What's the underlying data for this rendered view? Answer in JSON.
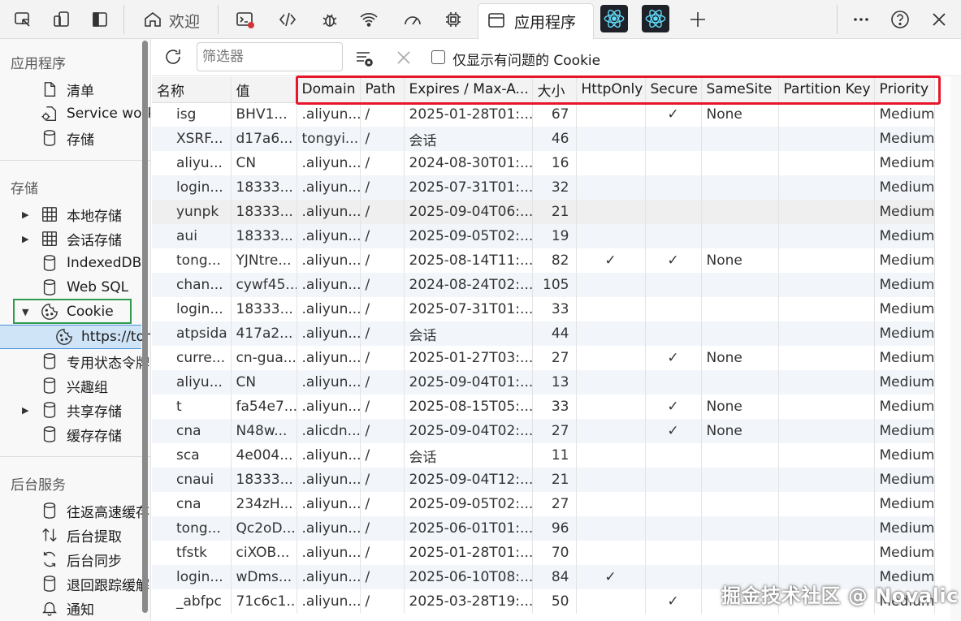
{
  "toolbar": {
    "tabs": [
      {
        "label": "欢迎",
        "icon": "home-icon"
      },
      {
        "label": "",
        "icon": "console-icon"
      },
      {
        "label": "",
        "icon": "sources-icon"
      },
      {
        "label": "",
        "icon": "bug-icon"
      },
      {
        "label": "",
        "icon": "network-icon"
      },
      {
        "label": "",
        "icon": "performance-icon"
      },
      {
        "label": "",
        "icon": "cpu-icon"
      },
      {
        "label": "应用程序",
        "icon": "application-icon"
      },
      {
        "label": "",
        "icon": "react-icon"
      },
      {
        "label": "",
        "icon": "react-icon"
      }
    ],
    "accent": "#0078d4"
  },
  "sidebar": {
    "section_app": "应用程序",
    "app_items": [
      {
        "label": "清单",
        "icon": "file-icon"
      },
      {
        "label": "Service workers",
        "icon": "gear-file-icon"
      },
      {
        "label": "存储",
        "icon": "database-icon"
      }
    ],
    "section_storage": "存储",
    "storage_items": [
      {
        "label": "本地存储",
        "icon": "grid-icon"
      },
      {
        "label": "会话存储",
        "icon": "grid-icon"
      },
      {
        "label": "IndexedDB",
        "icon": "database-icon"
      },
      {
        "label": "Web SQL",
        "icon": "database-icon"
      },
      {
        "label": "Cookie",
        "icon": "cookie-icon"
      },
      {
        "label": "https://tongyi.aliyun.com",
        "icon": "cookie-icon"
      },
      {
        "label": "专用状态令牌",
        "icon": "database-icon"
      },
      {
        "label": "兴趣组",
        "icon": "database-icon"
      },
      {
        "label": "共享存储",
        "icon": "database-icon"
      },
      {
        "label": "缓存存储",
        "icon": "database-icon"
      }
    ],
    "section_bg": "后台服务",
    "bg_items": [
      {
        "label": "往返高速缓存",
        "icon": "database-icon"
      },
      {
        "label": "后台提取",
        "icon": "sort-arrows-icon"
      },
      {
        "label": "后台同步",
        "icon": "sync-icon"
      },
      {
        "label": "退回跟踪缓解",
        "icon": "database-icon"
      },
      {
        "label": "通知",
        "icon": "bell-icon"
      }
    ]
  },
  "filterbar": {
    "placeholder": "筛选器",
    "checkbox_label": "仅显示有问题的 Cookie"
  },
  "table": {
    "headers": [
      "名称",
      "值",
      "Domain",
      "Path",
      "Expires / Max-A...",
      "大小",
      "HttpOnly",
      "Secure",
      "SameSite",
      "Partition Key",
      "Priority"
    ],
    "rows": [
      [
        "isg",
        "BHV1...",
        ".aliyun...",
        "/",
        "2025-01-28T01:...",
        "67",
        "",
        "✓",
        "None",
        "",
        "Medium"
      ],
      [
        "XSRF...",
        "d17a6...",
        "tongyi...",
        "/",
        "会话",
        "46",
        "",
        "",
        "",
        "",
        "Medium"
      ],
      [
        "aliyu...",
        "CN",
        ".aliyun...",
        "/",
        "2024-08-30T01:...",
        "16",
        "",
        "",
        "",
        "",
        "Medium"
      ],
      [
        "login...",
        "18333...",
        ".aliyun...",
        "/",
        "2025-07-31T01:...",
        "32",
        "",
        "",
        "",
        "",
        "Medium"
      ],
      [
        "yunpk",
        "18333...",
        ".aliyun...",
        "/",
        "2025-09-04T06:...",
        "21",
        "",
        "",
        "",
        "",
        "Medium"
      ],
      [
        "aui",
        "18333...",
        ".aliyun...",
        "/",
        "2025-09-05T02:...",
        "19",
        "",
        "",
        "",
        "",
        "Medium"
      ],
      [
        "tong...",
        "YJNtre...",
        ".aliyun...",
        "/",
        "2025-08-14T11:...",
        "82",
        "✓",
        "✓",
        "None",
        "",
        "Medium"
      ],
      [
        "chan...",
        "cywf45...",
        ".aliyun...",
        "/",
        "2024-08-24T02:...",
        "105",
        "",
        "",
        "",
        "",
        "Medium"
      ],
      [
        "login...",
        "18333...",
        ".aliyun...",
        "/",
        "2025-07-31T01:...",
        "33",
        "",
        "",
        "",
        "",
        "Medium"
      ],
      [
        "atpsida",
        "417a2...",
        ".aliyun...",
        "/",
        "会话",
        "44",
        "",
        "",
        "",
        "",
        "Medium"
      ],
      [
        "curre...",
        "cn-gua...",
        ".aliyun...",
        "/",
        "2025-01-27T03:...",
        "27",
        "",
        "✓",
        "None",
        "",
        "Medium"
      ],
      [
        "aliyu...",
        "CN",
        ".aliyun...",
        "/",
        "2025-09-04T01:...",
        "13",
        "",
        "",
        "",
        "",
        "Medium"
      ],
      [
        "t",
        "fa54e7...",
        ".aliyun...",
        "/",
        "2025-08-15T05:...",
        "33",
        "",
        "✓",
        "None",
        "",
        "Medium"
      ],
      [
        "cna",
        "N48w...",
        ".alicdn...",
        "/",
        "2025-09-04T02:...",
        "27",
        "",
        "✓",
        "None",
        "",
        "Medium"
      ],
      [
        "sca",
        "4e004...",
        ".aliyun...",
        "/",
        "会话",
        "11",
        "",
        "",
        "",
        "",
        "Medium"
      ],
      [
        "cnaui",
        "18333...",
        ".aliyun...",
        "/",
        "2025-09-04T12:...",
        "21",
        "",
        "",
        "",
        "",
        "Medium"
      ],
      [
        "cna",
        "234zH...",
        ".aliyun...",
        "/",
        "2025-09-05T02:...",
        "27",
        "",
        "",
        "",
        "",
        "Medium"
      ],
      [
        "tong...",
        "Qc2oD...",
        ".aliyun...",
        "/",
        "2025-06-01T01:...",
        "96",
        "",
        "",
        "",
        "",
        "Medium"
      ],
      [
        "tfstk",
        "ciXOB...",
        ".aliyun...",
        "/",
        "2025-01-28T01:...",
        "70",
        "",
        "",
        "",
        "",
        "Medium"
      ],
      [
        "login...",
        "wDms...",
        ".aliyun...",
        "/",
        "2025-06-10T08:...",
        "84",
        "✓",
        "",
        "",
        "",
        "Medium"
      ],
      [
        "_abfpc",
        "71c6c1...",
        ".aliyun...",
        "/",
        "2025-03-28T19:...",
        "50",
        "",
        "✓",
        "",
        "",
        "Medium"
      ]
    ]
  },
  "watermark": "掘金技术社区 @ Novalic"
}
